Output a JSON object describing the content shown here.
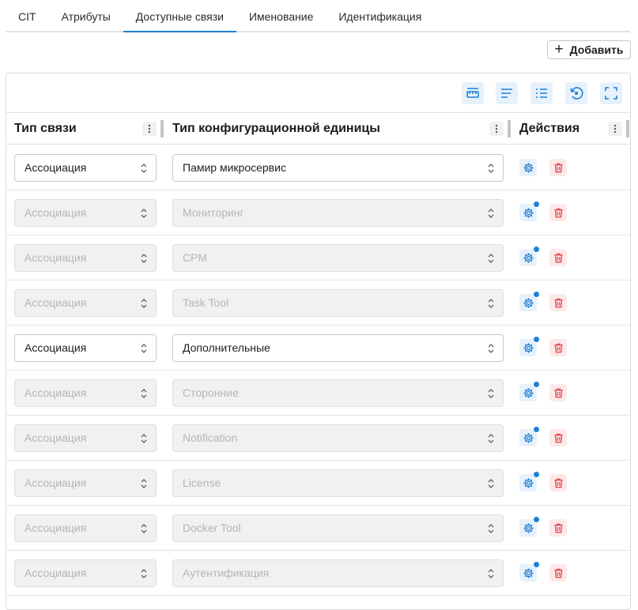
{
  "tabs": [
    {
      "label": "CIT",
      "active": false
    },
    {
      "label": "Атрибуты",
      "active": false
    },
    {
      "label": "Доступные связи",
      "active": true
    },
    {
      "label": "Именование",
      "active": false
    },
    {
      "label": "Идентификация",
      "active": false
    }
  ],
  "add_button": {
    "label": "Добавить",
    "icon": "plus-icon"
  },
  "toolbar": {
    "buttons": [
      {
        "name": "density-button",
        "icon": "ruler-icon"
      },
      {
        "name": "align-button",
        "icon": "align-icon"
      },
      {
        "name": "columns-button",
        "icon": "columns-list-icon"
      },
      {
        "name": "reset-button",
        "icon": "refresh-icon"
      },
      {
        "name": "fullscreen-button",
        "icon": "fullscreen-icon"
      }
    ]
  },
  "table": {
    "columns": [
      "Тип связи",
      "Тип конфигурационной единицы",
      "Действия"
    ],
    "rows": [
      {
        "relation": "Ассоциация",
        "ci_type": "Памир микросервис",
        "enabled": true,
        "has_indicator": false
      },
      {
        "relation": "Ассоциация",
        "ci_type": "Мониторинг",
        "enabled": false,
        "has_indicator": true
      },
      {
        "relation": "Ассоциация",
        "ci_type": "CPM",
        "enabled": false,
        "has_indicator": true
      },
      {
        "relation": "Ассоциация",
        "ci_type": "Task Tool",
        "enabled": false,
        "has_indicator": true
      },
      {
        "relation": "Ассоциация",
        "ci_type": "Дополнительные",
        "enabled": true,
        "has_indicator": true
      },
      {
        "relation": "Ассоциация",
        "ci_type": "Сторонние",
        "enabled": false,
        "has_indicator": true
      },
      {
        "relation": "Ассоциация",
        "ci_type": "Notification",
        "enabled": false,
        "has_indicator": true
      },
      {
        "relation": "Ассоциация",
        "ci_type": "License",
        "enabled": false,
        "has_indicator": true
      },
      {
        "relation": "Ассоциация",
        "ci_type": "Docker Tool",
        "enabled": false,
        "has_indicator": true
      },
      {
        "relation": "Ассоциация",
        "ci_type": "Аутентификация",
        "enabled": false,
        "has_indicator": true
      }
    ]
  },
  "colors": {
    "accent": "#1e7fd6",
    "danger": "#e5484d",
    "disabled_bg": "#f1f1f1",
    "disabled_text": "#b5b5b5"
  }
}
